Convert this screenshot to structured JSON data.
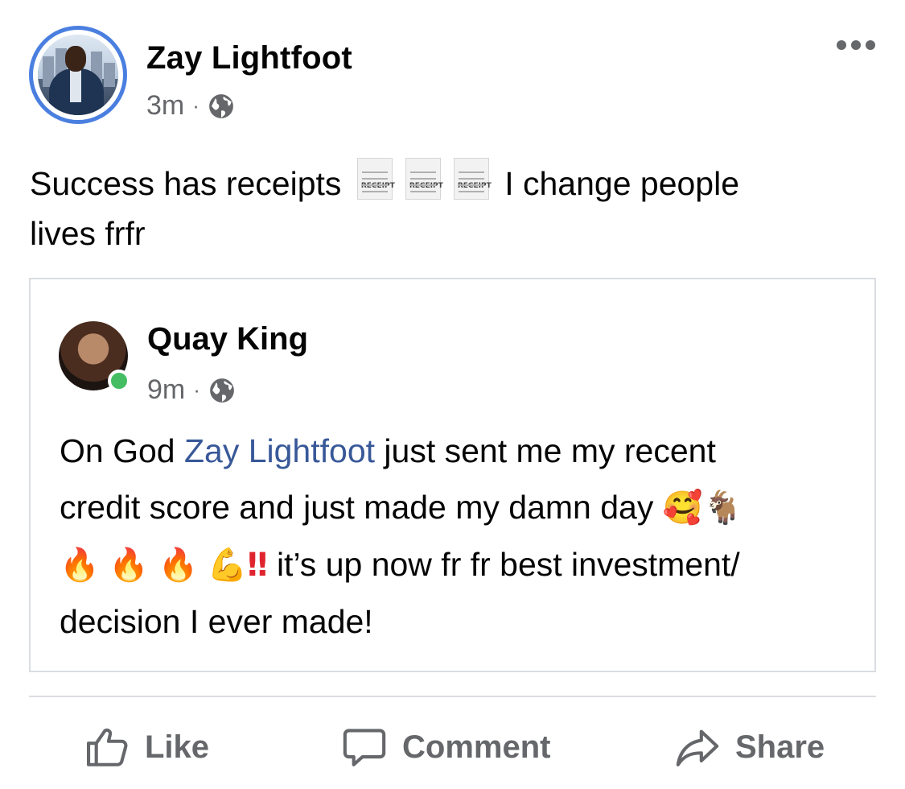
{
  "post": {
    "author": "Zay Lightfoot",
    "time": "3m",
    "separator": "·",
    "audience_icon": "globe-icon",
    "text_part1": "Success has receipts",
    "receipt_label": "RECEIPT",
    "text_part2": "I change people",
    "text_part3": "lives frfr",
    "menu_icon": "more-icon"
  },
  "shared": {
    "author": "Quay King",
    "time": "9m",
    "separator": "·",
    "online_status": "online",
    "text_before_mention": "On God ",
    "mention": "Zay Lightfoot",
    "text_after_mention": " just sent me my recent",
    "line2": "credit score and just made my damn day",
    "emoji_smile": "🥰",
    "emoji_goat": "🐐",
    "emoji_fire": "🔥",
    "emoji_arm": "💪",
    "emoji_bang": "‼",
    "line3_text": " it’s up now fr fr best investment/",
    "line4": "decision I ever made!"
  },
  "actions": {
    "like": "Like",
    "comment": "Comment",
    "share": "Share"
  },
  "colors": {
    "accent": "#4a7fe0",
    "mention": "#385898",
    "secondary_text": "#65676b",
    "online": "#45bd62",
    "border": "#dadde1"
  }
}
